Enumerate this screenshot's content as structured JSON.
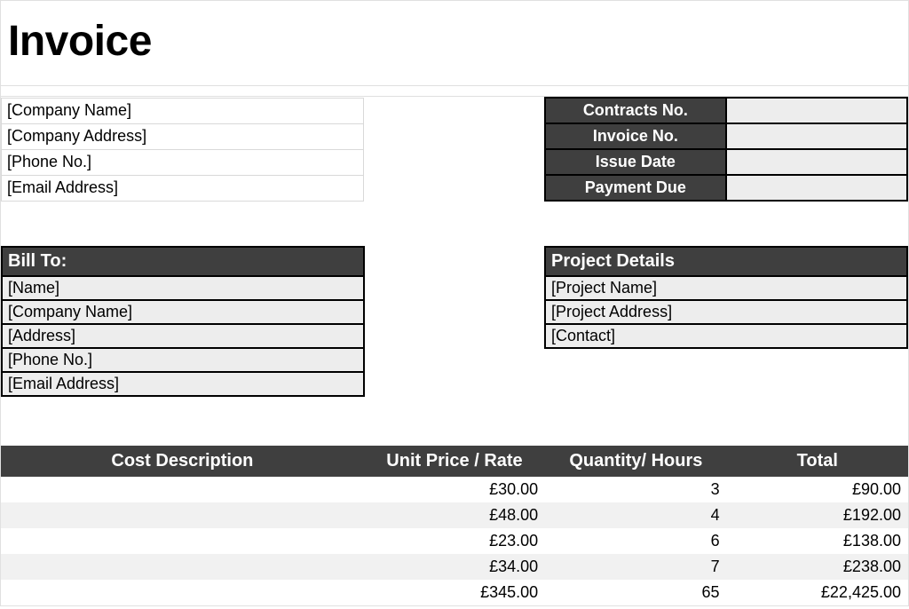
{
  "title": "Invoice",
  "sender": {
    "company": "[Company Name]",
    "address": "[Company Address]",
    "phone": "[Phone No.]",
    "email": "[Email Address]"
  },
  "meta": {
    "contracts_no_label": "Contracts No.",
    "contracts_no": "",
    "invoice_no_label": "Invoice No.",
    "invoice_no": "",
    "issue_date_label": "Issue Date",
    "issue_date": "",
    "payment_due_label": "Payment Due",
    "payment_due": ""
  },
  "bill_to": {
    "header": "Bill To:",
    "name": "[Name]",
    "company": "[Company Name]",
    "address": "[Address]",
    "phone": "[Phone No.]",
    "email": "[Email Address]"
  },
  "project": {
    "header": "Project Details",
    "name": "[Project Name]",
    "address": "[Project Address]",
    "contact": "[Contact]"
  },
  "columns": {
    "desc": "Cost Description",
    "unit": "Unit Price / Rate",
    "qty": "Quantity/ Hours",
    "total": "Total"
  },
  "lines": [
    {
      "desc": "",
      "unit": "£30.00",
      "qty": "3",
      "total": "£90.00"
    },
    {
      "desc": "",
      "unit": "£48.00",
      "qty": "4",
      "total": "£192.00"
    },
    {
      "desc": "",
      "unit": "£23.00",
      "qty": "6",
      "total": "£138.00"
    },
    {
      "desc": "",
      "unit": "£34.00",
      "qty": "7",
      "total": "£238.00"
    },
    {
      "desc": "",
      "unit": "£345.00",
      "qty": "65",
      "total": "£22,425.00"
    }
  ]
}
